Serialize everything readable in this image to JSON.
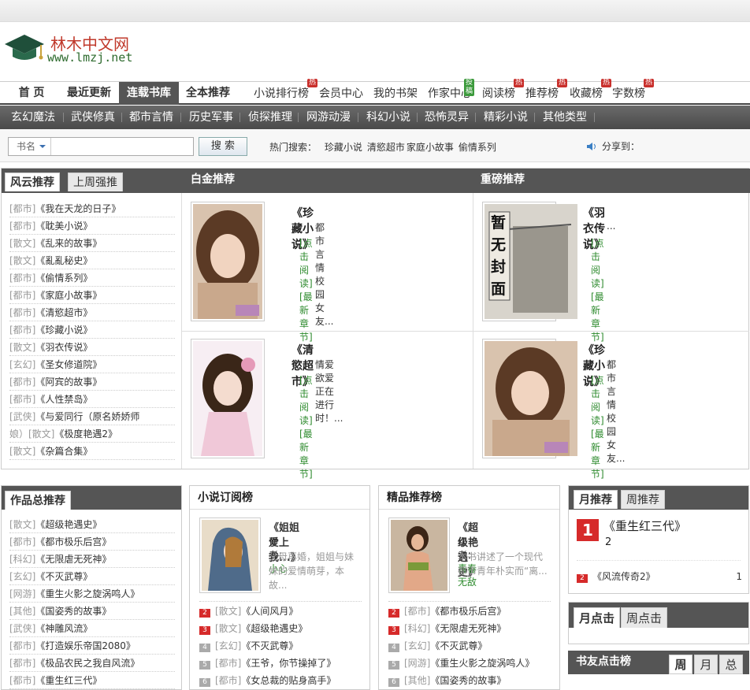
{
  "logo": {
    "name": "林木中文网",
    "url": "www.lmzj.net"
  },
  "main_nav": {
    "items": [
      "首 页",
      "最近更新",
      "连载书库",
      "全本推荐"
    ],
    "active": 2,
    "sub": [
      "小说排行榜",
      "会员中心",
      "我的书架",
      "作家中心",
      "阅读榜",
      "推荐榜",
      "收藏榜",
      "字数榜"
    ],
    "badges": {
      "hot": "热",
      "new": "投稿"
    }
  },
  "categories": [
    "玄幻魔法",
    "武侠修真",
    "都市言情",
    "历史军事",
    "侦探推理",
    "网游动漫",
    "科幻小说",
    "恐怖灵异",
    "精彩小说",
    "其他类型"
  ],
  "search": {
    "field": "书名",
    "button": "搜 索",
    "hot_label": "热门搜索：",
    "hot": [
      "珍藏小说",
      "清慾超市",
      "家庭小故事",
      "偷情系列"
    ],
    "share": "分享到："
  },
  "fengyun": {
    "tabs": [
      "风云推荐",
      "上周强推"
    ],
    "items": [
      {
        "cat": "[都市]",
        "title": "《我在天龙的日子》"
      },
      {
        "cat": "[都市]",
        "title": "《耽美小说》"
      },
      {
        "cat": "[散文]",
        "title": "《乱来的故事》"
      },
      {
        "cat": "[散文]",
        "title": "《亂亂秘史》"
      },
      {
        "cat": "[都市]",
        "title": "《偷情系列》"
      },
      {
        "cat": "[都市]",
        "title": "《家庭小故事》"
      },
      {
        "cat": "[都市]",
        "title": "《清慾超市》"
      },
      {
        "cat": "[都市]",
        "title": "《珍藏小说》"
      },
      {
        "cat": "[散文]",
        "title": "《羽衣传说》"
      },
      {
        "cat": "[玄幻]",
        "title": "《圣女修道院》"
      },
      {
        "cat": "[都市]",
        "title": "《阿宾的故事》"
      },
      {
        "cat": "[都市]",
        "title": "《人性禁岛》"
      },
      {
        "cat": "[武侠]",
        "title": "《与爱同行（原名娇娇师"
      },
      {
        "cat": "娘）[散文]",
        "title": "《极度艳遇2》"
      },
      {
        "cat": "[散文]",
        "title": "《杂篇合集》"
      }
    ]
  },
  "platinum": {
    "heading": "白金推荐",
    "books": [
      {
        "title": "《珍藏小说》",
        "desc": "都市 言情 校园 女友...",
        "read": "[点击阅读]",
        "latest": "[最新章节]"
      },
      {
        "title": "《清慾超市》",
        "desc": "情爱欲爱正在进行时！...",
        "read": "[点击阅读]",
        "latest": "[最新章节]"
      }
    ]
  },
  "heavy": {
    "heading": "重磅推荐",
    "books": [
      {
        "title": "《羽衣传说》",
        "desc": "...",
        "read": "[点击阅读]",
        "latest": "[最新章节]",
        "cover_text": "暂无封面"
      },
      {
        "title": "《珍藏小说》",
        "desc": "都市 言情 校园 女友...",
        "read": "[点击阅读]",
        "latest": "[最新章节]"
      }
    ]
  },
  "works": {
    "tab": "作品总推荐",
    "items": [
      {
        "cat": "[散文]",
        "title": "《超级艳遇史》"
      },
      {
        "cat": "[都市]",
        "title": "《都市极乐后宫》"
      },
      {
        "cat": "[科幻]",
        "title": "《无限虐无死神》"
      },
      {
        "cat": "[玄幻]",
        "title": "《不灭武尊》"
      },
      {
        "cat": "[网游]",
        "title": "《重生火影之旋涡鸣人》"
      },
      {
        "cat": "[其他]",
        "title": "《国姿秀的故事》"
      },
      {
        "cat": "[武侠]",
        "title": "《神雕风流》"
      },
      {
        "cat": "[都市]",
        "title": "《打造娱乐帝国2080》"
      },
      {
        "cat": "[都市]",
        "title": "《极品农民之我自风流》"
      },
      {
        "cat": "[都市]",
        "title": "《重生红三代》"
      }
    ]
  },
  "subscribe": {
    "heading": "小说订阅榜",
    "featured": {
      "title": "《姐姐爱上我...》",
      "author_label": "作者：",
      "author": "小心",
      "desc": "父母再婚，姐姐与妹妹的爱情萌芽，本故..."
    },
    "items": [
      {
        "n": "2",
        "cat": "[散文]",
        "title": "《人间风月》"
      },
      {
        "n": "3",
        "cat": "[散文]",
        "title": "《超级艳遇史》"
      },
      {
        "n": "4",
        "cat": "[玄幻]",
        "title": "《不灭武尊》"
      },
      {
        "n": "5",
        "cat": "[都市]",
        "title": "《王爷，你节操掉了》"
      },
      {
        "n": "6",
        "cat": "[都市]",
        "title": "《女总裁的贴身高手》"
      }
    ]
  },
  "quality": {
    "heading": "精品推荐榜",
    "featured": {
      "title": "《超级艳遇史》",
      "author_label": "作者：",
      "author": "青春无敌",
      "desc": "本书讲述了一个现代都市青年朴实而“离..."
    },
    "items": [
      {
        "n": "2",
        "cat": "[都市]",
        "title": "《都市极乐后宫》"
      },
      {
        "n": "3",
        "cat": "[科幻]",
        "title": "《无限虐无死神》"
      },
      {
        "n": "4",
        "cat": "[玄幻]",
        "title": "《不灭武尊》"
      },
      {
        "n": "5",
        "cat": "[网游]",
        "title": "《重生火影之旋涡鸣人》"
      },
      {
        "n": "6",
        "cat": "[其他]",
        "title": "《国姿秀的故事》"
      }
    ]
  },
  "monthly": {
    "tabs": [
      "月推荐",
      "周推荐"
    ],
    "top": {
      "n": "1",
      "title": "《重生红三代》",
      "count": "2"
    },
    "second": {
      "n": "2",
      "title": "《风流传奇2》",
      "count": "1"
    }
  },
  "clicks": {
    "tabs": [
      "月点击",
      "周点击"
    ]
  },
  "friends": {
    "heading": "书友点击榜",
    "tabs": [
      "周",
      "月",
      "总"
    ]
  }
}
